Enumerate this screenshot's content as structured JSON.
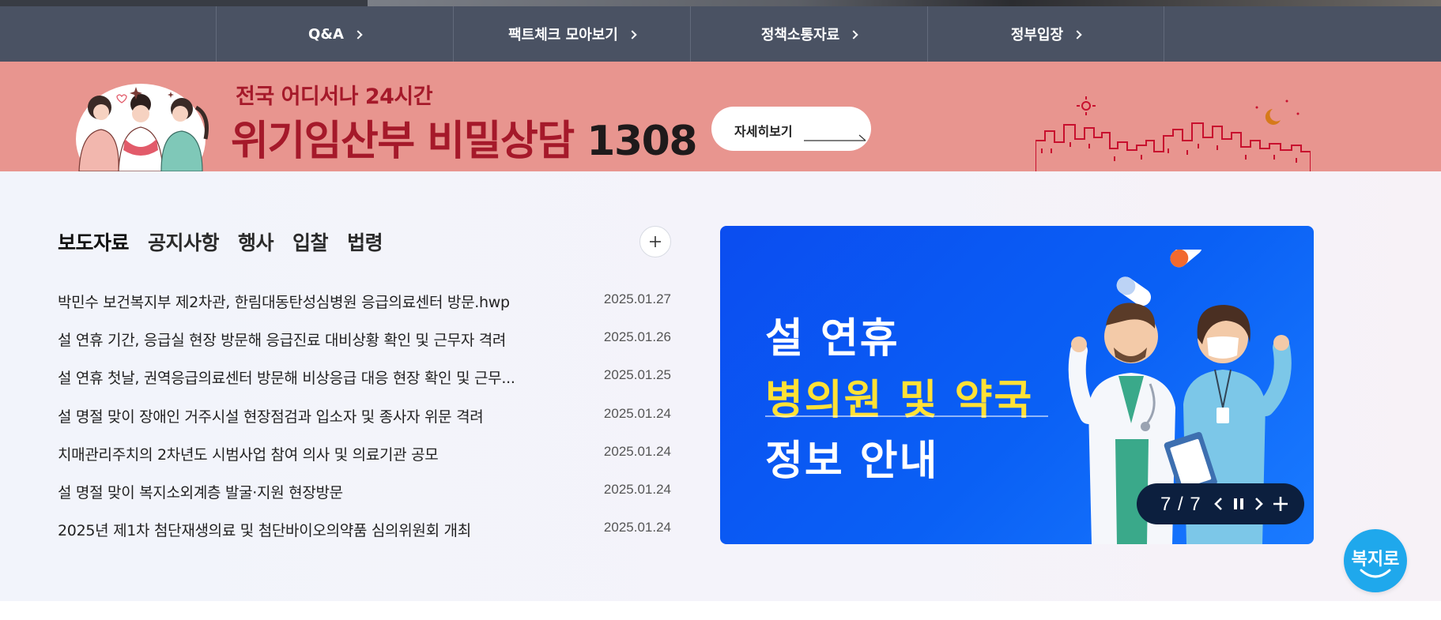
{
  "quick_nav": {
    "items": [
      {
        "label": "Q&A"
      },
      {
        "label": "팩트체크 모아보기"
      },
      {
        "label": "정책소통자료"
      },
      {
        "label": "정부입장"
      }
    ]
  },
  "banner": {
    "subtitle": "전국 어디서나 24시간",
    "title_main": "위기임산부 비밀상담 ",
    "title_number": "1308",
    "more_label": "자세히보기",
    "background_color": "#e8958f",
    "accent_color": "#a5192a"
  },
  "board": {
    "tabs": [
      {
        "label": "보도자료",
        "active": true
      },
      {
        "label": "공지사항",
        "active": false
      },
      {
        "label": "행사",
        "active": false
      },
      {
        "label": "입찰",
        "active": false
      },
      {
        "label": "법령",
        "active": false
      }
    ],
    "more_icon": "plus-icon",
    "items": [
      {
        "title": "박민수 보건복지부 제2차관, 한림대동탄성심병원 응급의료센터 방문.hwp",
        "date": "2025.01.27"
      },
      {
        "title": "설 연휴 기간, 응급실 현장 방문해 응급진료 대비상황 확인 및 근무자 격려",
        "date": "2025.01.26"
      },
      {
        "title": "설 연휴 첫날, 권역응급의료센터 방문해 비상응급 대응 현장 확인 및 근무...",
        "date": "2025.01.25"
      },
      {
        "title": "설 명절 맞이 장애인 거주시설 현장점검과 입소자 및 종사자 위문 격려",
        "date": "2025.01.24"
      },
      {
        "title": "치매관리주치의 2차년도 시범사업 참여 의사 및 의료기관 공모",
        "date": "2025.01.24"
      },
      {
        "title": "설 명절 맞이 복지소외계층 발굴·지원 현장방문",
        "date": "2025.01.24"
      },
      {
        "title": "2025년 제1차 첨단재생의료 및 첨단바이오의약품 심의위원회 개최",
        "date": "2025.01.24"
      }
    ]
  },
  "promo": {
    "line1": "설 연휴",
    "line2": "병의원 및 약국",
    "line3": "정보 안내",
    "counter": "7 / 7",
    "highlight_color": "#ffe136",
    "controls": [
      "chevron-left-icon",
      "pause-icon",
      "chevron-right-icon",
      "plus-icon"
    ]
  },
  "floating": {
    "label": "복지로",
    "color": "#1fa8ec"
  }
}
